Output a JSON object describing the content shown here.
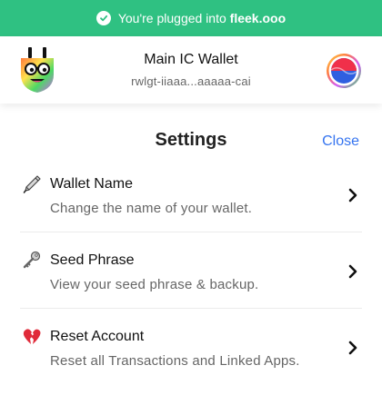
{
  "banner": {
    "message_prefix": "You're plugged into ",
    "site": "fleek.ooo",
    "icon": "check-circle-icon"
  },
  "header": {
    "wallet_name": "Main IC Wallet",
    "wallet_id": "rwlgt-iiaaa...aaaaa-cai",
    "logo_icon": "plug-logo",
    "avatar_icon": "wallet-avatar"
  },
  "settings": {
    "title": "Settings",
    "close_label": "Close",
    "items": [
      {
        "title": "Wallet Name",
        "description": "Change the name of your wallet.",
        "icon": "pen-icon"
      },
      {
        "title": "Seed Phrase",
        "description": "View your seed phrase & backup.",
        "icon": "key-icon"
      },
      {
        "title": "Reset Account",
        "description": "Reset all Transactions and Linked Apps.",
        "icon": "broken-heart-icon"
      }
    ]
  },
  "colors": {
    "banner_bg": "#2fc182",
    "link": "#3574f0",
    "secondary_text": "#666666"
  }
}
